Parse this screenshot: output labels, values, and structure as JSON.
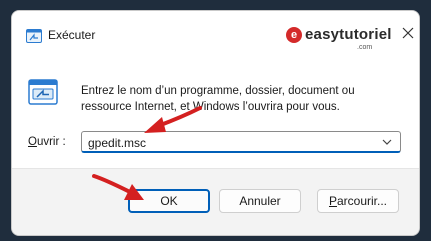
{
  "window": {
    "title": "Exécuter",
    "close_glyph": "✕"
  },
  "watermark": {
    "badge": "e",
    "brand": "easytutoriel",
    "domain": ".com"
  },
  "content": {
    "description": "Entrez le nom d’un programme, dossier, document ou ressource Internet, et Windows l’ouvrira pour vous.",
    "open_label_underlined": "O",
    "open_label_rest": "uvrir :",
    "command_value": "gpedit.msc"
  },
  "buttons": {
    "ok": "OK",
    "cancel": "Annuler",
    "browse_underlined": "P",
    "browse_rest": "arcourir..."
  },
  "colors": {
    "accent": "#005fb8",
    "annotation_arrow": "#d42020",
    "brand_red": "#d42a2a"
  },
  "icons": [
    "run-app-icon",
    "run-dialog-icon",
    "close-icon",
    "chevron-down-icon",
    "red-arrow-annotation"
  ]
}
